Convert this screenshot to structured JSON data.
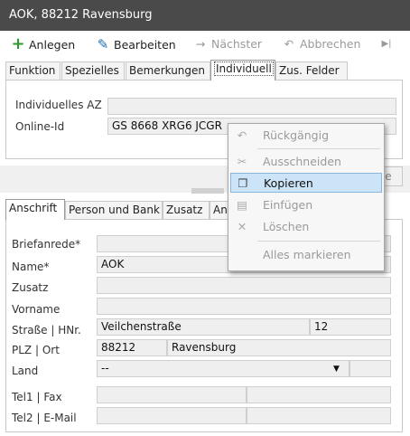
{
  "window": {
    "title": "AOK, 88212 Ravensburg"
  },
  "toolbar": {
    "add": "Anlegen",
    "edit": "Bearbeiten",
    "next": "Nächster",
    "cancel": "Abbrechen"
  },
  "top_tabs": [
    {
      "label": "Funktion"
    },
    {
      "label": "Spezielles"
    },
    {
      "label": "Bemerkungen"
    },
    {
      "label": "Individuell"
    },
    {
      "label": "Zus. Felder"
    }
  ],
  "individual": {
    "az_label": "Individuelles AZ",
    "az_value": "",
    "online_id_label": "Online-Id",
    "online_id_value": "GS 8668 XRG6 JCGR"
  },
  "partial_button": "se",
  "bottom_tabs": [
    {
      "label": "Anschrift"
    },
    {
      "label": "Person und Bank"
    },
    {
      "label": "Zusatz"
    },
    {
      "label": "An"
    }
  ],
  "address": {
    "salutation_label": "Briefanrede*",
    "salutation_value": "",
    "name_label": "Name*",
    "name_value": "AOK",
    "addition_label": "Zusatz",
    "addition_value": "",
    "firstname_label": "Vorname",
    "firstname_value": "",
    "street_label": "Straße | HNr.",
    "street_value": "Veilchenstraße",
    "house_number": "12",
    "zip_city_label": "PLZ | Ort",
    "zip": "88212",
    "city": "Ravensburg",
    "country_label": "Land",
    "country_value": "--",
    "tel_fax_label": "Tel1 | Fax",
    "tel2_email_label": "Tel2 | E-Mail"
  },
  "context_menu": {
    "undo": "Rückgängig",
    "cut": "Ausschneiden",
    "copy": "Kopieren",
    "paste": "Einfügen",
    "delete": "Löschen",
    "select_all": "Alles markieren"
  },
  "colors": {
    "titlebar": "#4a4a4a",
    "add_icon": "#2e9a2e",
    "edit_icon": "#1e6fb5",
    "menu_highlight": "#cce4f7"
  }
}
